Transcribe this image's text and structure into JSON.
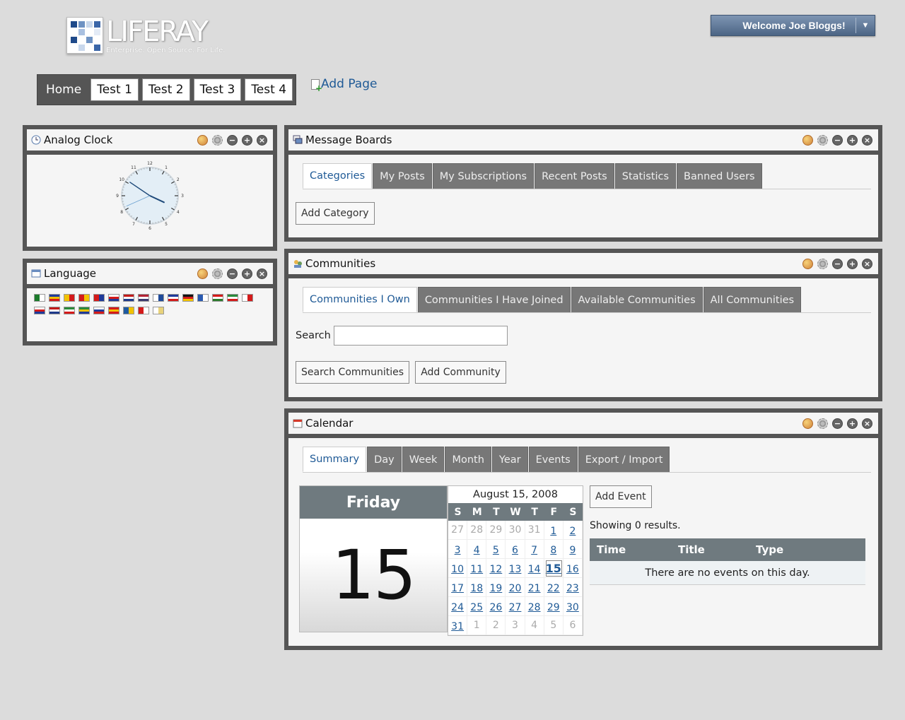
{
  "header": {
    "logo_text": "LIFERAY",
    "logo_tagline": "Enterprise. Open Source. For Life.",
    "welcome_label": "Welcome Joe Bloggs!",
    "welcome_arrow": "▼"
  },
  "nav": {
    "tabs": [
      {
        "label": "Home"
      },
      {
        "label": "Test 1"
      },
      {
        "label": "Test 2"
      },
      {
        "label": "Test 3"
      },
      {
        "label": "Test 4"
      }
    ],
    "add_page_label": "Add Page"
  },
  "tools": {
    "minimize": "−",
    "maximize": "+",
    "close": "×"
  },
  "clock": {
    "title": "Analog Clock",
    "numerals": [
      "12",
      "1",
      "2",
      "3",
      "4",
      "5",
      "6",
      "7",
      "8",
      "9",
      "10",
      "11"
    ],
    "time": {
      "hour": 3,
      "minute": 50,
      "second": 41
    }
  },
  "language": {
    "title": "Language",
    "flags": [
      {
        "name": "flag-arabic",
        "colors": [
          "#1a7a2a",
          "#ffffff"
        ]
      },
      {
        "name": "flag-catalan-andorra",
        "colors": [
          "#1f3a9a",
          "#f2c200",
          "#d41a1a"
        ]
      },
      {
        "name": "flag-catalan",
        "colors": [
          "#f2c200",
          "#d41a1a"
        ]
      },
      {
        "name": "flag-china",
        "colors": [
          "#d41a1a",
          "#f2c200"
        ]
      },
      {
        "name": "flag-taiwan",
        "colors": [
          "#d41a1a",
          "#1f3a9a"
        ]
      },
      {
        "name": "flag-czech",
        "colors": [
          "#ffffff",
          "#d41a1a",
          "#1f3a9a"
        ]
      },
      {
        "name": "flag-netherlands",
        "colors": [
          "#c21a1a",
          "#ffffff",
          "#1f3a8a"
        ]
      },
      {
        "name": "flag-usa",
        "colors": [
          "#b22234",
          "#ffffff",
          "#3c3b6e"
        ]
      },
      {
        "name": "flag-finland",
        "colors": [
          "#ffffff",
          "#1f4a9a"
        ]
      },
      {
        "name": "flag-france",
        "colors": [
          "#1f3a9a",
          "#ffffff",
          "#d41a1a"
        ]
      },
      {
        "name": "flag-germany",
        "colors": [
          "#111111",
          "#d41a1a",
          "#f2c200"
        ]
      },
      {
        "name": "flag-greece",
        "colors": [
          "#2a5ab0",
          "#ffffff"
        ]
      },
      {
        "name": "flag-hungary",
        "colors": [
          "#d41a1a",
          "#ffffff",
          "#2a7a2a"
        ]
      },
      {
        "name": "flag-italy",
        "colors": [
          "#2a8a3a",
          "#ffffff",
          "#d41a1a"
        ]
      },
      {
        "name": "flag-japan",
        "colors": [
          "#ffffff",
          "#d41a1a"
        ]
      },
      {
        "name": "flag-korea",
        "colors": [
          "#ffffff",
          "#d41a1a",
          "#1f3a9a"
        ]
      },
      {
        "name": "flag-norway",
        "colors": [
          "#c21a1a",
          "#ffffff",
          "#1f3a8a"
        ]
      },
      {
        "name": "flag-iran",
        "colors": [
          "#2a8a3a",
          "#ffffff",
          "#d41a1a"
        ]
      },
      {
        "name": "flag-brazil",
        "colors": [
          "#2a8a3a",
          "#f2c200",
          "#1f3a9a"
        ]
      },
      {
        "name": "flag-russia",
        "colors": [
          "#ffffff",
          "#1f3a9a",
          "#d41a1a"
        ]
      },
      {
        "name": "flag-spain",
        "colors": [
          "#d41a1a",
          "#f2c200",
          "#d41a1a"
        ]
      },
      {
        "name": "flag-sweden",
        "colors": [
          "#1f5aa0",
          "#f2c200"
        ]
      },
      {
        "name": "flag-turkey",
        "colors": [
          "#d41a1a",
          "#ffffff"
        ]
      },
      {
        "name": "flag-vietnam-yellow",
        "colors": [
          "#ffffff",
          "#e8d27a"
        ]
      }
    ]
  },
  "message_boards": {
    "title": "Message Boards",
    "tabs": [
      "Categories",
      "My Posts",
      "My Subscriptions",
      "Recent Posts",
      "Statistics",
      "Banned Users"
    ],
    "active_tab": 0,
    "add_category_label": "Add Category"
  },
  "communities": {
    "title": "Communities",
    "tabs": [
      "Communities I Own",
      "Communities I Have Joined",
      "Available Communities",
      "All Communities"
    ],
    "active_tab": 0,
    "search_label": "Search",
    "search_value": "",
    "search_button": "Search Communities",
    "add_button": "Add Community"
  },
  "calendar": {
    "title": "Calendar",
    "tabs": [
      "Summary",
      "Day",
      "Week",
      "Month",
      "Year",
      "Events",
      "Export / Import"
    ],
    "active_tab": 0,
    "day_name": "Friday",
    "day_number": "15",
    "month_title": "August 15, 2008",
    "weekdays": [
      "S",
      "M",
      "T",
      "W",
      "T",
      "F",
      "S"
    ],
    "weeks": [
      [
        [
          "27",
          "other"
        ],
        [
          "28",
          "other"
        ],
        [
          "29",
          "other"
        ],
        [
          "30",
          "other"
        ],
        [
          "31",
          "other"
        ],
        [
          "1",
          "cur"
        ],
        [
          "2",
          "cur"
        ]
      ],
      [
        [
          "3",
          "cur"
        ],
        [
          "4",
          "cur"
        ],
        [
          "5",
          "cur"
        ],
        [
          "6",
          "cur"
        ],
        [
          "7",
          "cur"
        ],
        [
          "8",
          "cur"
        ],
        [
          "9",
          "cur"
        ]
      ],
      [
        [
          "10",
          "cur"
        ],
        [
          "11",
          "cur"
        ],
        [
          "12",
          "cur"
        ],
        [
          "13",
          "cur"
        ],
        [
          "14",
          "cur"
        ],
        [
          "15",
          "today"
        ],
        [
          "16",
          "cur"
        ]
      ],
      [
        [
          "17",
          "cur"
        ],
        [
          "18",
          "cur"
        ],
        [
          "19",
          "cur"
        ],
        [
          "20",
          "cur"
        ],
        [
          "21",
          "cur"
        ],
        [
          "22",
          "cur"
        ],
        [
          "23",
          "cur"
        ]
      ],
      [
        [
          "24",
          "cur"
        ],
        [
          "25",
          "cur"
        ],
        [
          "26",
          "cur"
        ],
        [
          "27",
          "cur"
        ],
        [
          "28",
          "cur"
        ],
        [
          "29",
          "cur"
        ],
        [
          "30",
          "cur"
        ]
      ],
      [
        [
          "31",
          "cur"
        ],
        [
          "1",
          "other"
        ],
        [
          "2",
          "other"
        ],
        [
          "3",
          "other"
        ],
        [
          "4",
          "other"
        ],
        [
          "5",
          "other"
        ],
        [
          "6",
          "other"
        ]
      ]
    ],
    "add_event_label": "Add Event",
    "results_text": "Showing 0 results.",
    "columns": [
      "Time",
      "Title",
      "Type"
    ],
    "empty_text": "There are no events on this day."
  }
}
